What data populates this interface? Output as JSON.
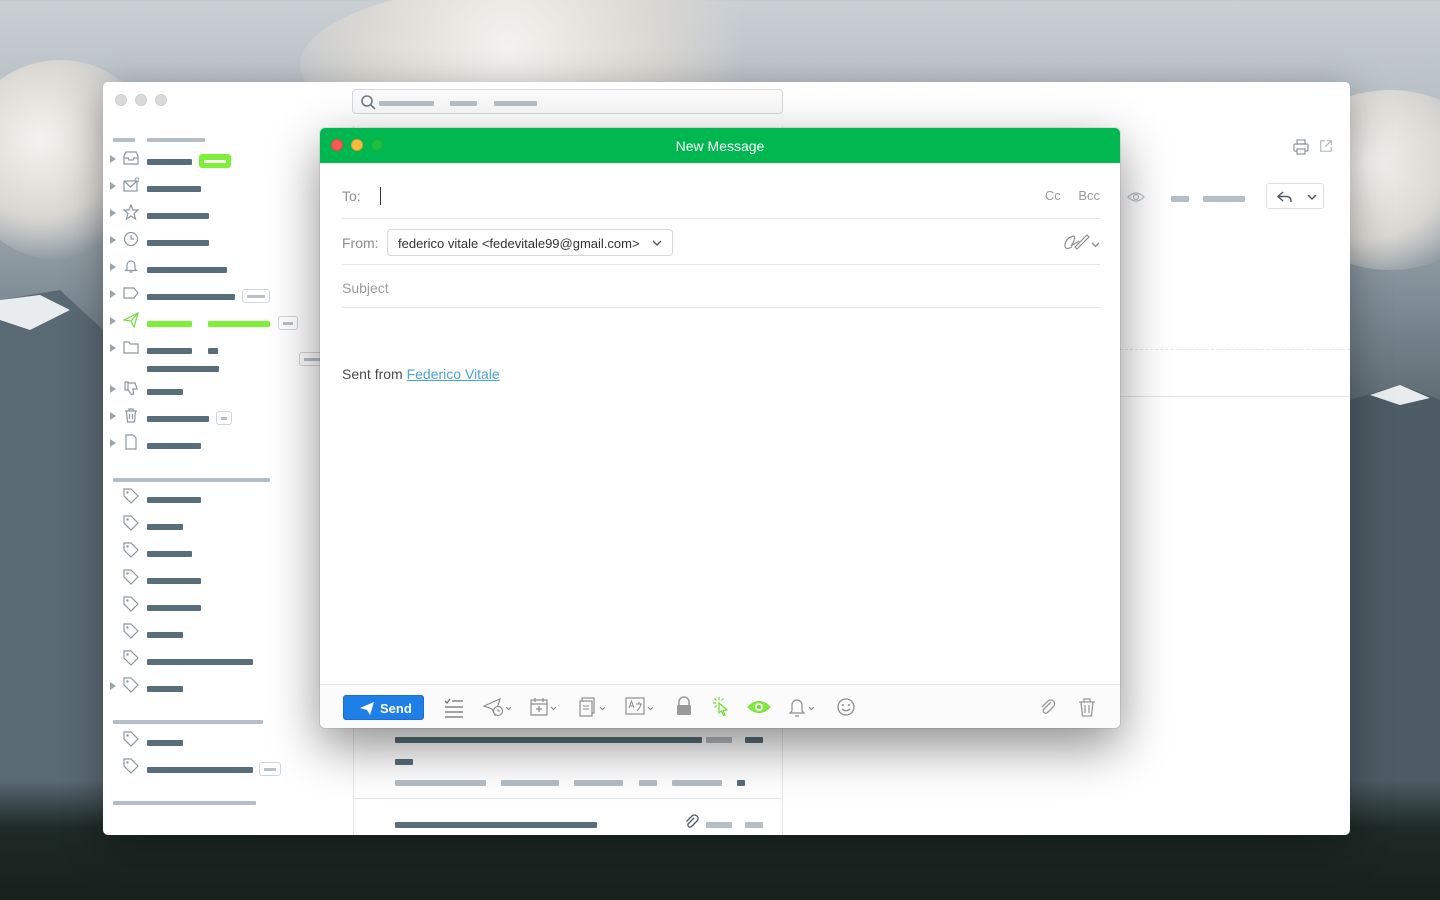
{
  "compose": {
    "title": "New Message",
    "to_label": "To:",
    "cc_label": "Cc",
    "bcc_label": "Bcc",
    "from_label": "From:",
    "from_value": "federico vitale <fedevitale99@gmail.com>",
    "subject_placeholder": "Subject",
    "body_prefix": "Sent from ",
    "body_link": "Federico Vitale",
    "send_label": "Send"
  },
  "colors": {
    "titlebar": "#00b84f",
    "send_button": "#1f7fe8",
    "accent_green": "#7ef03a",
    "link": "#4aa4d6"
  },
  "toolbar_icons": [
    "checklist-icon",
    "send-later-icon",
    "calendar-icon",
    "templates-icon",
    "translate-icon",
    "lock-icon",
    "click-tracking-icon",
    "read-receipt-icon",
    "reminder-icon",
    "emoji-icon",
    "attachment-icon",
    "trash-icon"
  ]
}
